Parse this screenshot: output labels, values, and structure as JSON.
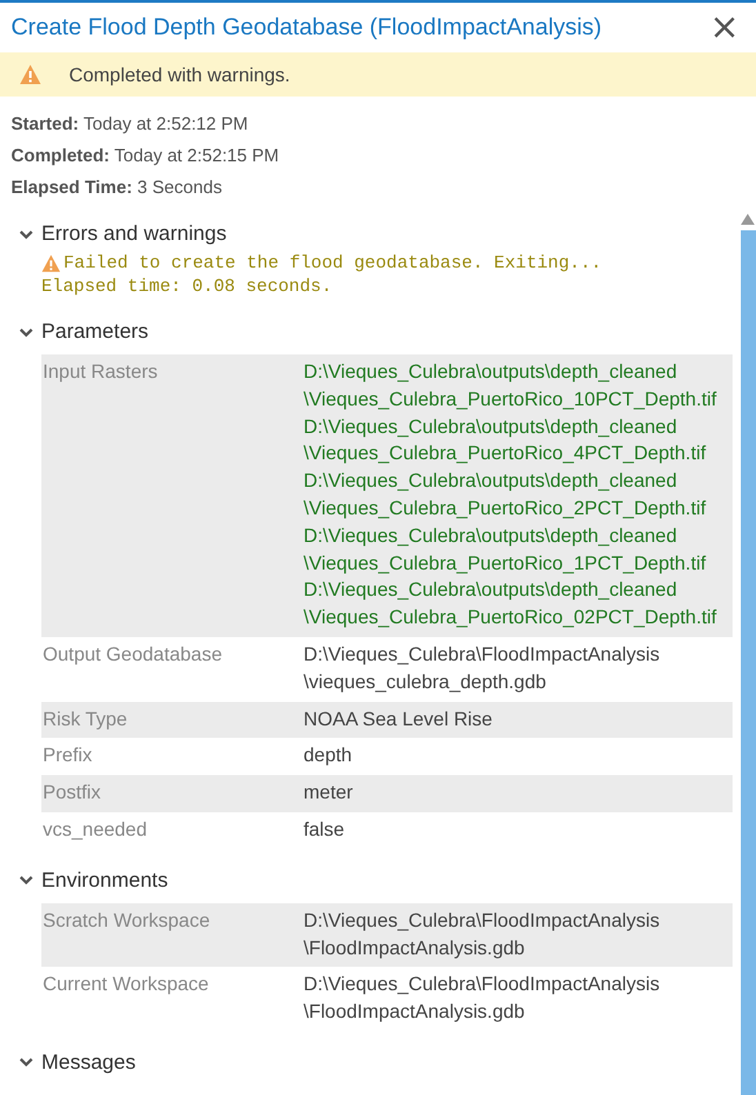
{
  "window": {
    "title": "Create Flood Depth Geodatabase (FloodImpactAnalysis)",
    "close": "×"
  },
  "status": {
    "kind": "warning",
    "text": "Completed with warnings."
  },
  "info": [
    {
      "label": "Started:",
      "value": "Today at 2:52:12 PM"
    },
    {
      "label": "Completed:",
      "value": "Today at 2:52:15 PM"
    },
    {
      "label": "Elapsed Time:",
      "value": "3 Seconds"
    }
  ],
  "sections": [
    {
      "title": "Errors and warnings",
      "expanded": true,
      "kind": "messages",
      "messages": [
        {
          "kind": "warning",
          "lines": [
            "Failed to create the flood geodatabase. Exiting...",
            "Elapsed time: 0.08 seconds."
          ]
        }
      ]
    },
    {
      "title": "Parameters",
      "expanded": true,
      "kind": "table",
      "rows": [
        {
          "label": "Input Rasters",
          "kind": "input_dataset",
          "lines": [
            "D:\\Vieques_Culebra\\outputs\\depth_cleaned",
            "\\Vieques_Culebra_PuertoRico_10PCT_Depth.tif",
            "D:\\Vieques_Culebra\\outputs\\depth_cleaned",
            "\\Vieques_Culebra_PuertoRico_4PCT_Depth.tif",
            "D:\\Vieques_Culebra\\outputs\\depth_cleaned",
            "\\Vieques_Culebra_PuertoRico_2PCT_Depth.tif",
            "D:\\Vieques_Culebra\\outputs\\depth_cleaned",
            "\\Vieques_Culebra_PuertoRico_1PCT_Depth.tif",
            "D:\\Vieques_Culebra\\outputs\\depth_cleaned",
            "\\Vieques_Culebra_PuertoRico_02PCT_Depth.tif"
          ]
        },
        {
          "label": "Output Geodatabase",
          "kind": "value",
          "lines": [
            "D:\\Vieques_Culebra\\FloodImpactAnalysis",
            "\\vieques_culebra_depth.gdb"
          ]
        },
        {
          "label": "Risk Type",
          "kind": "value",
          "lines": [
            "NOAA Sea Level Rise"
          ]
        },
        {
          "label": "Prefix",
          "kind": "value",
          "lines": [
            "depth"
          ]
        },
        {
          "label": "Postfix",
          "kind": "value",
          "lines": [
            "meter"
          ]
        },
        {
          "label": "vcs_needed",
          "kind": "value",
          "lines": [
            "false"
          ]
        }
      ]
    },
    {
      "title": "Environments",
      "expanded": true,
      "kind": "table",
      "rows": [
        {
          "label": "Scratch Workspace",
          "kind": "value",
          "lines": [
            "D:\\Vieques_Culebra\\FloodImpactAnalysis",
            "\\FloodImpactAnalysis.gdb"
          ]
        },
        {
          "label": "Current Workspace",
          "kind": "value",
          "lines": [
            "D:\\Vieques_Culebra\\FloodImpactAnalysis",
            "\\FloodImpactAnalysis.gdb"
          ]
        }
      ]
    },
    {
      "title": "Messages",
      "expanded": true,
      "kind": "collapsed_view"
    }
  ]
}
